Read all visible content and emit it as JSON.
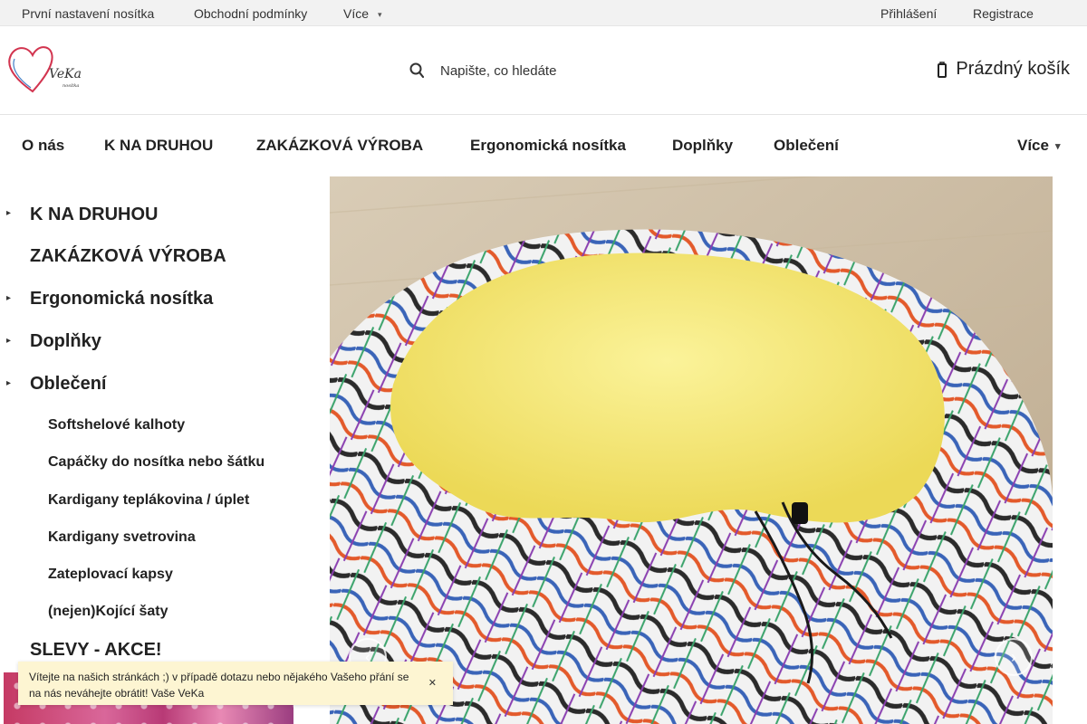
{
  "topbar": {
    "links": [
      "První nastavení nosítka",
      "Obchodní podmínky",
      "Více"
    ],
    "login": "Přihlášení",
    "register": "Registrace"
  },
  "header": {
    "logo_text": "VeKa",
    "logo_sub": "nosítka",
    "search_placeholder": "Napište, co hledáte",
    "cart_label": "Prázdný košík",
    "icons": {
      "search": "search-icon",
      "cart": "cart-icon"
    }
  },
  "nav": {
    "items": [
      "O nás",
      "K NA DRUHOU",
      "ZAKÁZKOVÁ VÝROBA",
      "Ergonomická nosítka",
      "Doplňky",
      "Oblečení"
    ],
    "more": "Více"
  },
  "sidebar": {
    "categories": [
      "K NA DRUHOU",
      "ZAKÁZKOVÁ VÝROBA",
      "Ergonomická nosítka",
      "Doplňky",
      "Oblečení"
    ],
    "subcategories": [
      "Softshelové kalhoty",
      "Capáčky do nosítka nebo šátku",
      "Kardigany teplákovina / úplet",
      "Kardigany svetrovina",
      "Zateplovací kapsy",
      "(nejen)Kojící šaty"
    ],
    "sale": "SLEVY - AKCE!"
  },
  "welcome": {
    "message": "Vítejte na našich stránkách ;) v případě dotazu nebo nějakého Vašeho přání se na nás neváhejte obrátit! Vaše VeKa"
  },
  "colors": {
    "topbar_bg": "#f2f2f2",
    "welcome_bg": "#fdf5d2",
    "logo_heart": "#d2344f",
    "fleece_yellow": "#f6ec7c"
  }
}
